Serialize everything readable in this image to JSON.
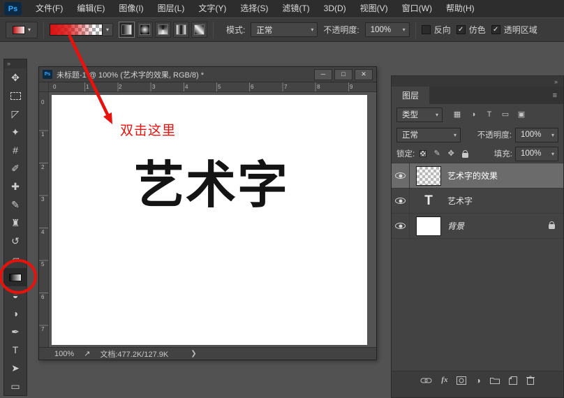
{
  "icons": {
    "caret": "▾",
    "collapse": "»",
    "panel_menu": "≡",
    "minimize": "─",
    "maximize": "□",
    "close": "✕",
    "status_arrow": "↗",
    "fx": "fx",
    "adjustment": "◑"
  },
  "menubar": {
    "logo": "Ps",
    "items": [
      "文件(F)",
      "编辑(E)",
      "图像(I)",
      "图层(L)",
      "文字(Y)",
      "选择(S)",
      "滤镜(T)",
      "3D(D)",
      "视图(V)",
      "窗口(W)",
      "帮助(H)"
    ]
  },
  "options": {
    "mode_label": "模式:",
    "mode_value": "正常",
    "opacity_label": "不透明度:",
    "opacity_value": "100%",
    "reverse_label": "反向",
    "reverse_check": "",
    "dither_label": "仿色",
    "dither_check": "✓",
    "transparency_label": "透明区域",
    "transparency_check": "✓"
  },
  "toolbar": {
    "tools": [
      {
        "name": "move",
        "glyph": "✥"
      },
      {
        "name": "marquee",
        "glyph": ""
      },
      {
        "name": "lasso",
        "glyph": "◸"
      },
      {
        "name": "quick-select",
        "glyph": "✦"
      },
      {
        "name": "crop",
        "glyph": "#"
      },
      {
        "name": "eyedropper",
        "glyph": "✐"
      },
      {
        "name": "healing-brush",
        "glyph": "✚"
      },
      {
        "name": "brush",
        "glyph": "✎"
      },
      {
        "name": "clone-stamp",
        "glyph": "♜"
      },
      {
        "name": "history-brush",
        "glyph": "↺"
      },
      {
        "name": "eraser",
        "glyph": "▱"
      },
      {
        "name": "gradient",
        "glyph": ""
      },
      {
        "name": "blur",
        "glyph": "◒"
      },
      {
        "name": "dodge",
        "glyph": "◑"
      },
      {
        "name": "pen",
        "glyph": "✒"
      },
      {
        "name": "type",
        "glyph": "T"
      },
      {
        "name": "path-selection",
        "glyph": "➤"
      },
      {
        "name": "shape",
        "glyph": "▭"
      }
    ]
  },
  "document": {
    "title": "未标题-1 @ 100% (艺术字的效果, RGB/8) *",
    "ruler_h": [
      "0",
      "1",
      "2",
      "3",
      "4",
      "5",
      "6",
      "7",
      "8",
      "9"
    ],
    "ruler_v": [
      "0",
      "1",
      "2",
      "3",
      "4",
      "5",
      "6",
      "7"
    ],
    "annotation": "双击这里",
    "art_text": "艺术字",
    "status": {
      "zoom": "100%",
      "doc_info": "文档:477.2K/127.9K",
      "chevron": "❯"
    }
  },
  "layers": {
    "tab": "图层",
    "filter_label": "类型",
    "filter_icons": [
      {
        "name": "pixel-filter",
        "glyph": "▦"
      },
      {
        "name": "adjustment-filter",
        "glyph": "◑"
      },
      {
        "name": "type-filter",
        "glyph": "T"
      },
      {
        "name": "shape-filter",
        "glyph": "▭"
      },
      {
        "name": "smart-object-filter",
        "glyph": "▣"
      }
    ],
    "blend_value": "正常",
    "opacity_label": "不透明度:",
    "opacity_value": "100%",
    "lock_label": "锁定:",
    "lock_icons": [
      {
        "name": "lock-transparency",
        "glyph": ""
      },
      {
        "name": "lock-pixels",
        "glyph": "✎"
      },
      {
        "name": "lock-position",
        "glyph": "✥"
      },
      {
        "name": "lock-all",
        "glyph": ""
      }
    ],
    "fill_label": "填充:",
    "fill_value": "100%",
    "items": [
      {
        "name": "艺术字的效果",
        "selected": true
      },
      {
        "name": "艺术字",
        "thumb": "T",
        "selected": false
      },
      {
        "name": "背景",
        "selected": false,
        "locked": true
      }
    ]
  },
  "colors": {
    "annotation_red": "#e8120c",
    "canvas_white": "#ffffff"
  }
}
